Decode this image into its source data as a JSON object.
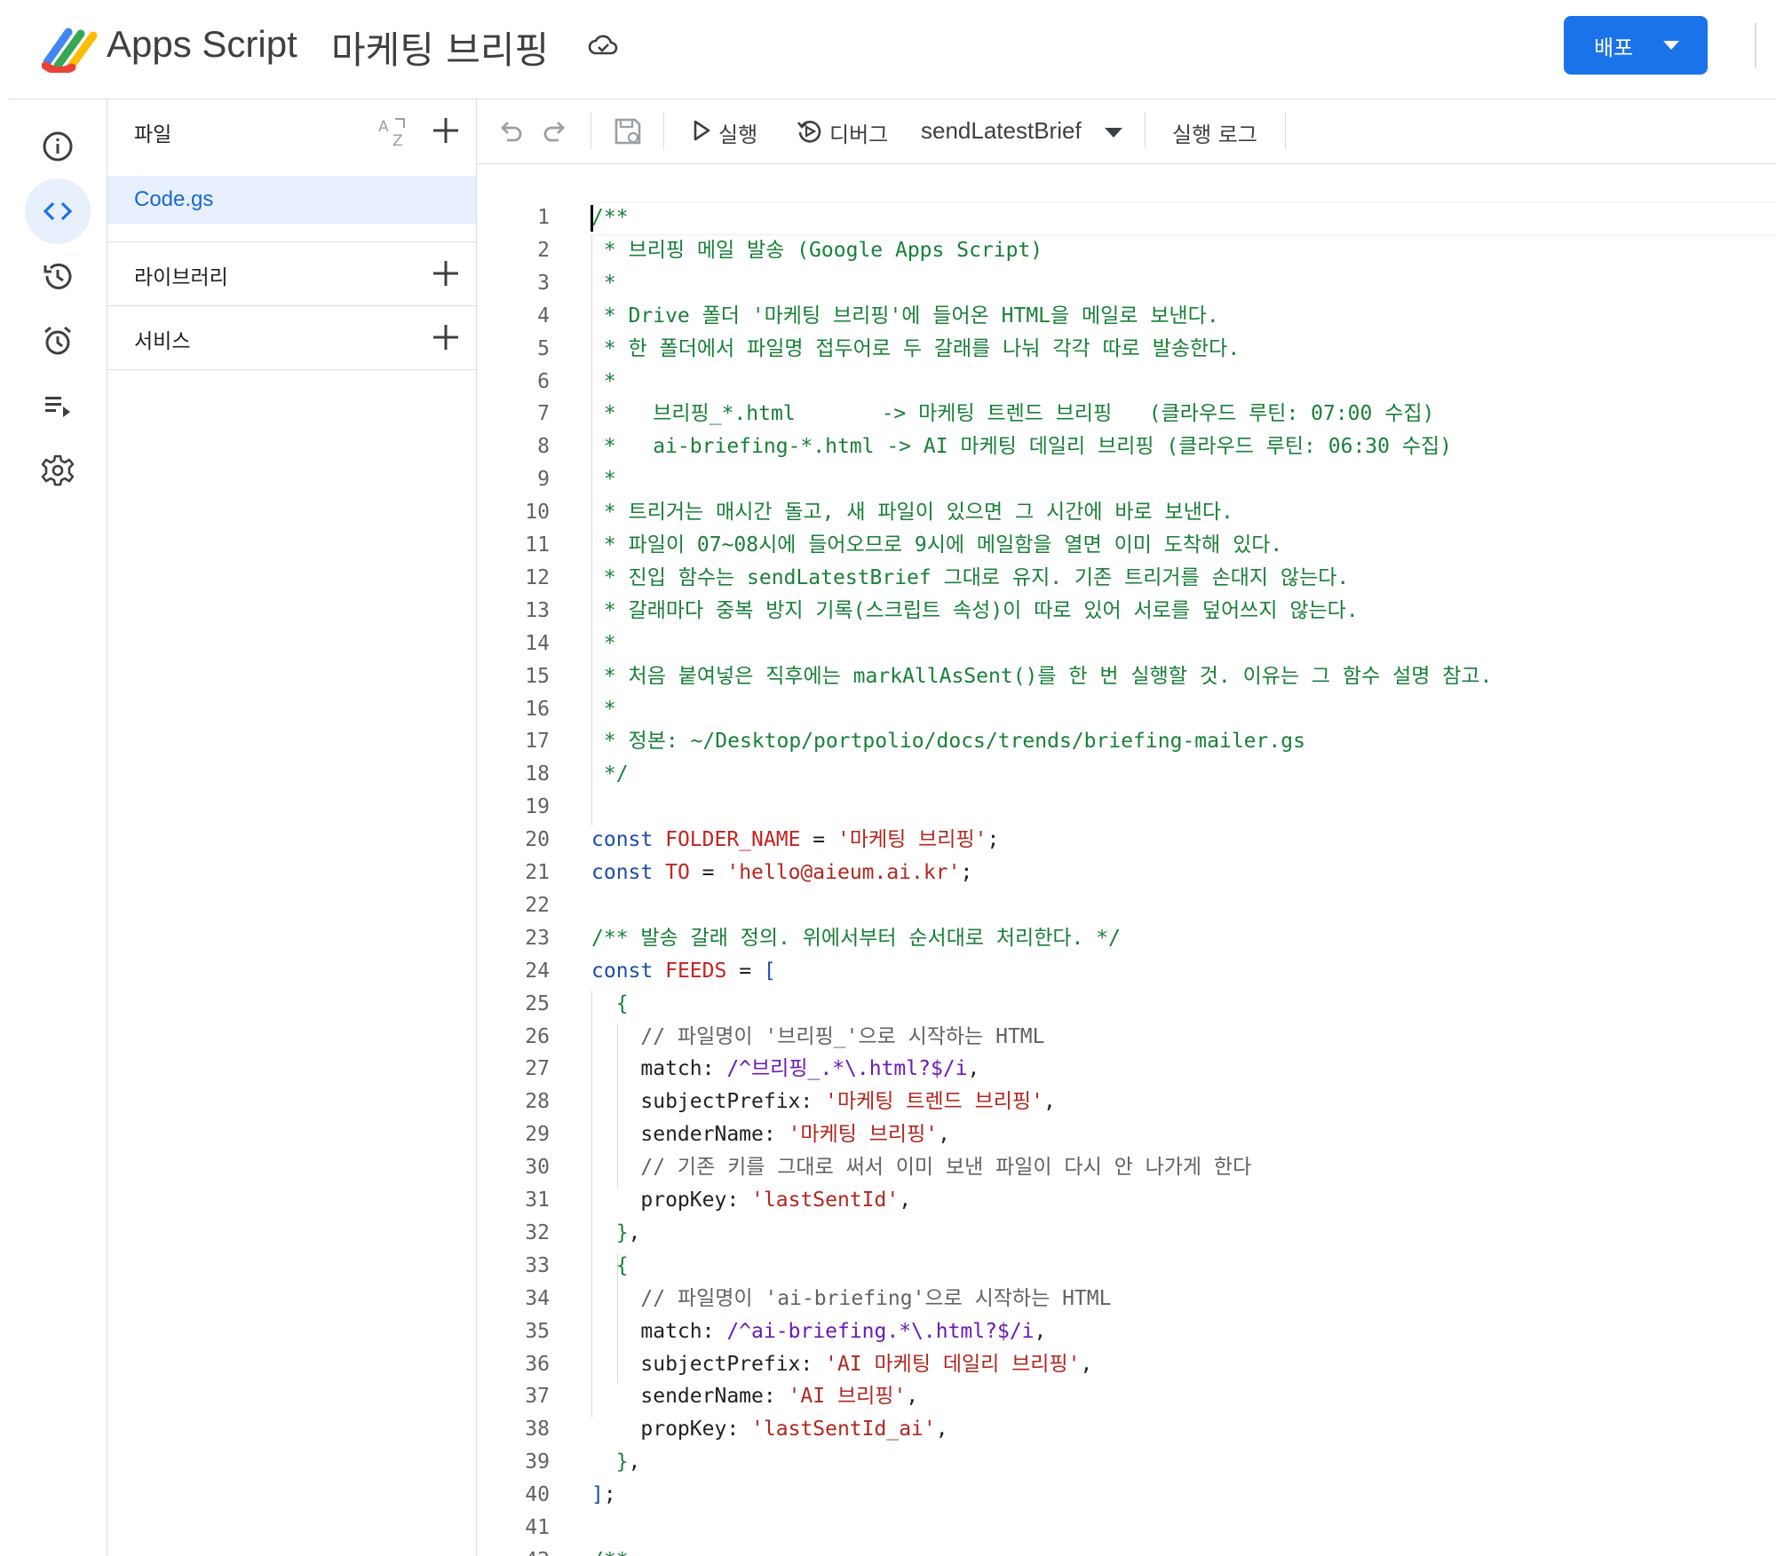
{
  "header": {
    "app_name": "Apps Script",
    "project_title": "마케팅 브리핑",
    "deploy_label": "배포"
  },
  "rail": {
    "items": [
      {
        "name": "overview",
        "icon": "info-icon"
      },
      {
        "name": "editor",
        "icon": "code-icon",
        "active": true
      },
      {
        "name": "history",
        "icon": "history-icon"
      },
      {
        "name": "triggers",
        "icon": "alarm-icon"
      },
      {
        "name": "executions",
        "icon": "executions-icon"
      },
      {
        "name": "settings",
        "icon": "gear-icon"
      }
    ]
  },
  "files_panel": {
    "files_label": "파일",
    "sort_icon": "sort-az-icon",
    "files": [
      "Code.gs"
    ],
    "libraries_label": "라이브러리",
    "services_label": "서비스"
  },
  "toolbar": {
    "run_label": "실행",
    "debug_label": "디버그",
    "function_selected": "sendLatestBrief",
    "log_label": "실행 로그"
  },
  "colors": {
    "accent": "#1a73e8",
    "selected_bg": "#e8f0fe",
    "comment": "#188038",
    "keyword": "#1a4ea8",
    "string": "#b3261e",
    "regex": "#6a1ab8"
  },
  "editor": {
    "lines": [
      [
        [
          "/**",
          "comment"
        ]
      ],
      [
        [
          " * 브리핑 메일 발송 (Google Apps Script)",
          "comment"
        ]
      ],
      [
        [
          " *",
          "comment"
        ]
      ],
      [
        [
          " * Drive 폴더 '마케팅 브리핑'에 들어온 HTML을 메일로 보낸다.",
          "comment"
        ]
      ],
      [
        [
          " * 한 폴더에서 파일명 접두어로 두 갈래를 나눠 각각 따로 발송한다.",
          "comment"
        ]
      ],
      [
        [
          " *",
          "comment"
        ]
      ],
      [
        [
          " *   브리핑_*.html       -> 마케팅 트렌드 브리핑   (클라우드 루틴: 07:00 수집)",
          "comment"
        ]
      ],
      [
        [
          " *   ai-briefing-*.html -> AI 마케팅 데일리 브리핑 (클라우드 루틴: 06:30 수집)",
          "comment"
        ]
      ],
      [
        [
          " *",
          "comment"
        ]
      ],
      [
        [
          " * 트리거는 매시간 돌고, 새 파일이 있으면 그 시간에 바로 보낸다.",
          "comment"
        ]
      ],
      [
        [
          " * 파일이 07~08시에 들어오므로 9시에 메일함을 열면 이미 도착해 있다.",
          "comment"
        ]
      ],
      [
        [
          " * 진입 함수는 sendLatestBrief 그대로 유지. 기존 트리거를 손대지 않는다.",
          "comment"
        ]
      ],
      [
        [
          " * 갈래마다 중복 방지 기록(스크립트 속성)이 따로 있어 서로를 덮어쓰지 않는다.",
          "comment"
        ]
      ],
      [
        [
          " *",
          "comment"
        ]
      ],
      [
        [
          " * 처음 붙여넣은 직후에는 markAllAsSent()를 한 번 실행할 것. 이유는 그 함수 설명 참고.",
          "comment"
        ]
      ],
      [
        [
          " *",
          "comment"
        ]
      ],
      [
        [
          " * 정본: ~/Desktop/portpolio/docs/trends/briefing-mailer.gs",
          "comment"
        ]
      ],
      [
        [
          " */",
          "comment"
        ]
      ],
      [],
      [
        [
          "const ",
          "kw"
        ],
        [
          "FOLDER_NAME",
          "var"
        ],
        [
          " = ",
          "punc"
        ],
        [
          "'마케팅 브리핑'",
          "str"
        ],
        [
          ";",
          "punc"
        ]
      ],
      [
        [
          "const ",
          "kw"
        ],
        [
          "TO",
          "var"
        ],
        [
          " = ",
          "punc"
        ],
        [
          "'hello@aieum.ai.kr'",
          "str"
        ],
        [
          ";",
          "punc"
        ]
      ],
      [],
      [
        [
          "/** 발송 갈래 정의. 위에서부터 순서대로 처리한다. */",
          "comment"
        ]
      ],
      [
        [
          "const ",
          "kw"
        ],
        [
          "FEEDS",
          "var"
        ],
        [
          " = ",
          "punc"
        ],
        [
          "[",
          "kw"
        ]
      ],
      [
        [
          "  {",
          "comment"
        ]
      ],
      [
        [
          "    // 파일명이 '브리핑_'으로 시작하는 HTML",
          "gray"
        ]
      ],
      [
        [
          "    match",
          "prop"
        ],
        [
          ": ",
          "punc"
        ],
        [
          "/^브리핑_.*\\.html?$/i",
          "re"
        ],
        [
          ",",
          "punc"
        ]
      ],
      [
        [
          "    subjectPrefix",
          "prop"
        ],
        [
          ": ",
          "punc"
        ],
        [
          "'마케팅 트렌드 브리핑'",
          "str"
        ],
        [
          ",",
          "punc"
        ]
      ],
      [
        [
          "    senderName",
          "prop"
        ],
        [
          ": ",
          "punc"
        ],
        [
          "'마케팅 브리핑'",
          "str"
        ],
        [
          ",",
          "punc"
        ]
      ],
      [
        [
          "    // 기존 키를 그대로 써서 이미 보낸 파일이 다시 안 나가게 한다",
          "gray"
        ]
      ],
      [
        [
          "    propKey",
          "prop"
        ],
        [
          ": ",
          "punc"
        ],
        [
          "'lastSentId'",
          "str"
        ],
        [
          ",",
          "punc"
        ]
      ],
      [
        [
          "  }",
          "comment"
        ],
        [
          ",",
          "punc"
        ]
      ],
      [
        [
          "  {",
          "comment"
        ]
      ],
      [
        [
          "    // 파일명이 'ai-briefing'으로 시작하는 HTML",
          "gray"
        ]
      ],
      [
        [
          "    match",
          "prop"
        ],
        [
          ": ",
          "punc"
        ],
        [
          "/^ai-briefing.*\\.html?$/i",
          "re"
        ],
        [
          ",",
          "punc"
        ]
      ],
      [
        [
          "    subjectPrefix",
          "prop"
        ],
        [
          ": ",
          "punc"
        ],
        [
          "'AI 마케팅 데일리 브리핑'",
          "str"
        ],
        [
          ",",
          "punc"
        ]
      ],
      [
        [
          "    senderName",
          "prop"
        ],
        [
          ": ",
          "punc"
        ],
        [
          "'AI 브리핑'",
          "str"
        ],
        [
          ",",
          "punc"
        ]
      ],
      [
        [
          "    propKey",
          "prop"
        ],
        [
          ": ",
          "punc"
        ],
        [
          "'lastSentId_ai'",
          "str"
        ],
        [
          ",",
          "punc"
        ]
      ],
      [
        [
          "  }",
          "comment"
        ],
        [
          ",",
          "punc"
        ]
      ],
      [
        [
          "]",
          "kw"
        ],
        [
          ";",
          "punc"
        ]
      ],
      [],
      [
        [
          "/**",
          "comment"
        ]
      ]
    ]
  }
}
